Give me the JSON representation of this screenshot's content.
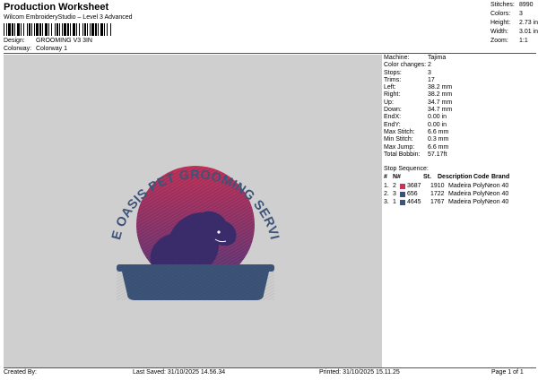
{
  "header": {
    "title": "Production Worksheet",
    "subtitle": "Wilcom EmbroideryStudio – Level 3 Advanced",
    "design_label": "Design:",
    "design_value": "GROOMING V3 3IN",
    "colorway_label": "Colorway:",
    "colorway_value": "Colorway 1"
  },
  "stats": [
    {
      "label": "Stitches:",
      "value": "8990"
    },
    {
      "label": "Colors:",
      "value": "3"
    },
    {
      "label": "Height:",
      "value": "2.73 in"
    },
    {
      "label": "Width:",
      "value": "3.01 in"
    },
    {
      "label": "Zoom:",
      "value": "1:1"
    }
  ],
  "machine_info": [
    {
      "label": "Machine:",
      "value": "Tajima"
    },
    {
      "label": "Color changes:",
      "value": "2"
    },
    {
      "label": "Stops:",
      "value": "3"
    },
    {
      "label": "Trims:",
      "value": "17"
    },
    {
      "label": "Left:",
      "value": "38.2 mm"
    },
    {
      "label": "Right:",
      "value": "38.2 mm"
    },
    {
      "label": "Up:",
      "value": "34.7 mm"
    },
    {
      "label": "Down:",
      "value": "34.7 mm"
    },
    {
      "label": "EndX:",
      "value": "0.00 in"
    },
    {
      "label": "EndY:",
      "value": "0.00 in"
    },
    {
      "label": "Max Stitch:",
      "value": "6.6 mm"
    },
    {
      "label": "Min Stitch:",
      "value": "0.3 mm"
    },
    {
      "label": "Max Jump:",
      "value": "6.6 mm"
    },
    {
      "label": "Total Bobbin:",
      "value": "57.17ft"
    }
  ],
  "stop_sequence": {
    "title": "Stop Sequence:",
    "headers": [
      "#",
      "N#",
      "St.",
      "Description",
      "Code",
      "Brand"
    ],
    "rows": [
      {
        "idx": "1.",
        "n": "2",
        "swatch": "#c8335a",
        "code_name": "3687",
        "st": "1910",
        "brand": "Madeira PolyNeon 40"
      },
      {
        "idx": "2.",
        "n": "3",
        "swatch": "#3b4f7c",
        "code_name": "656",
        "st": "1722",
        "brand": "Madeira PolyNeon 40"
      },
      {
        "idx": "3.",
        "n": "1",
        "swatch": "#3d5479",
        "code_name": "4645",
        "st": "1767",
        "brand": "Madeira PolyNeon 40"
      }
    ]
  },
  "design": {
    "arc_text": "BLUE OASIS PET GROOMING SERVICES",
    "colors": {
      "sun_top": "#c8335a",
      "sun_bottom": "#6a3a7a",
      "navy": "#3d5479",
      "bg": "#cfcfcf"
    }
  },
  "footer": {
    "created_by": "Created By:",
    "last_saved": "Last Saved: 31/10/2025 14.56.34",
    "printed": "Printed: 31/10/2025 15.11.25",
    "page": "Page 1 of 1"
  }
}
